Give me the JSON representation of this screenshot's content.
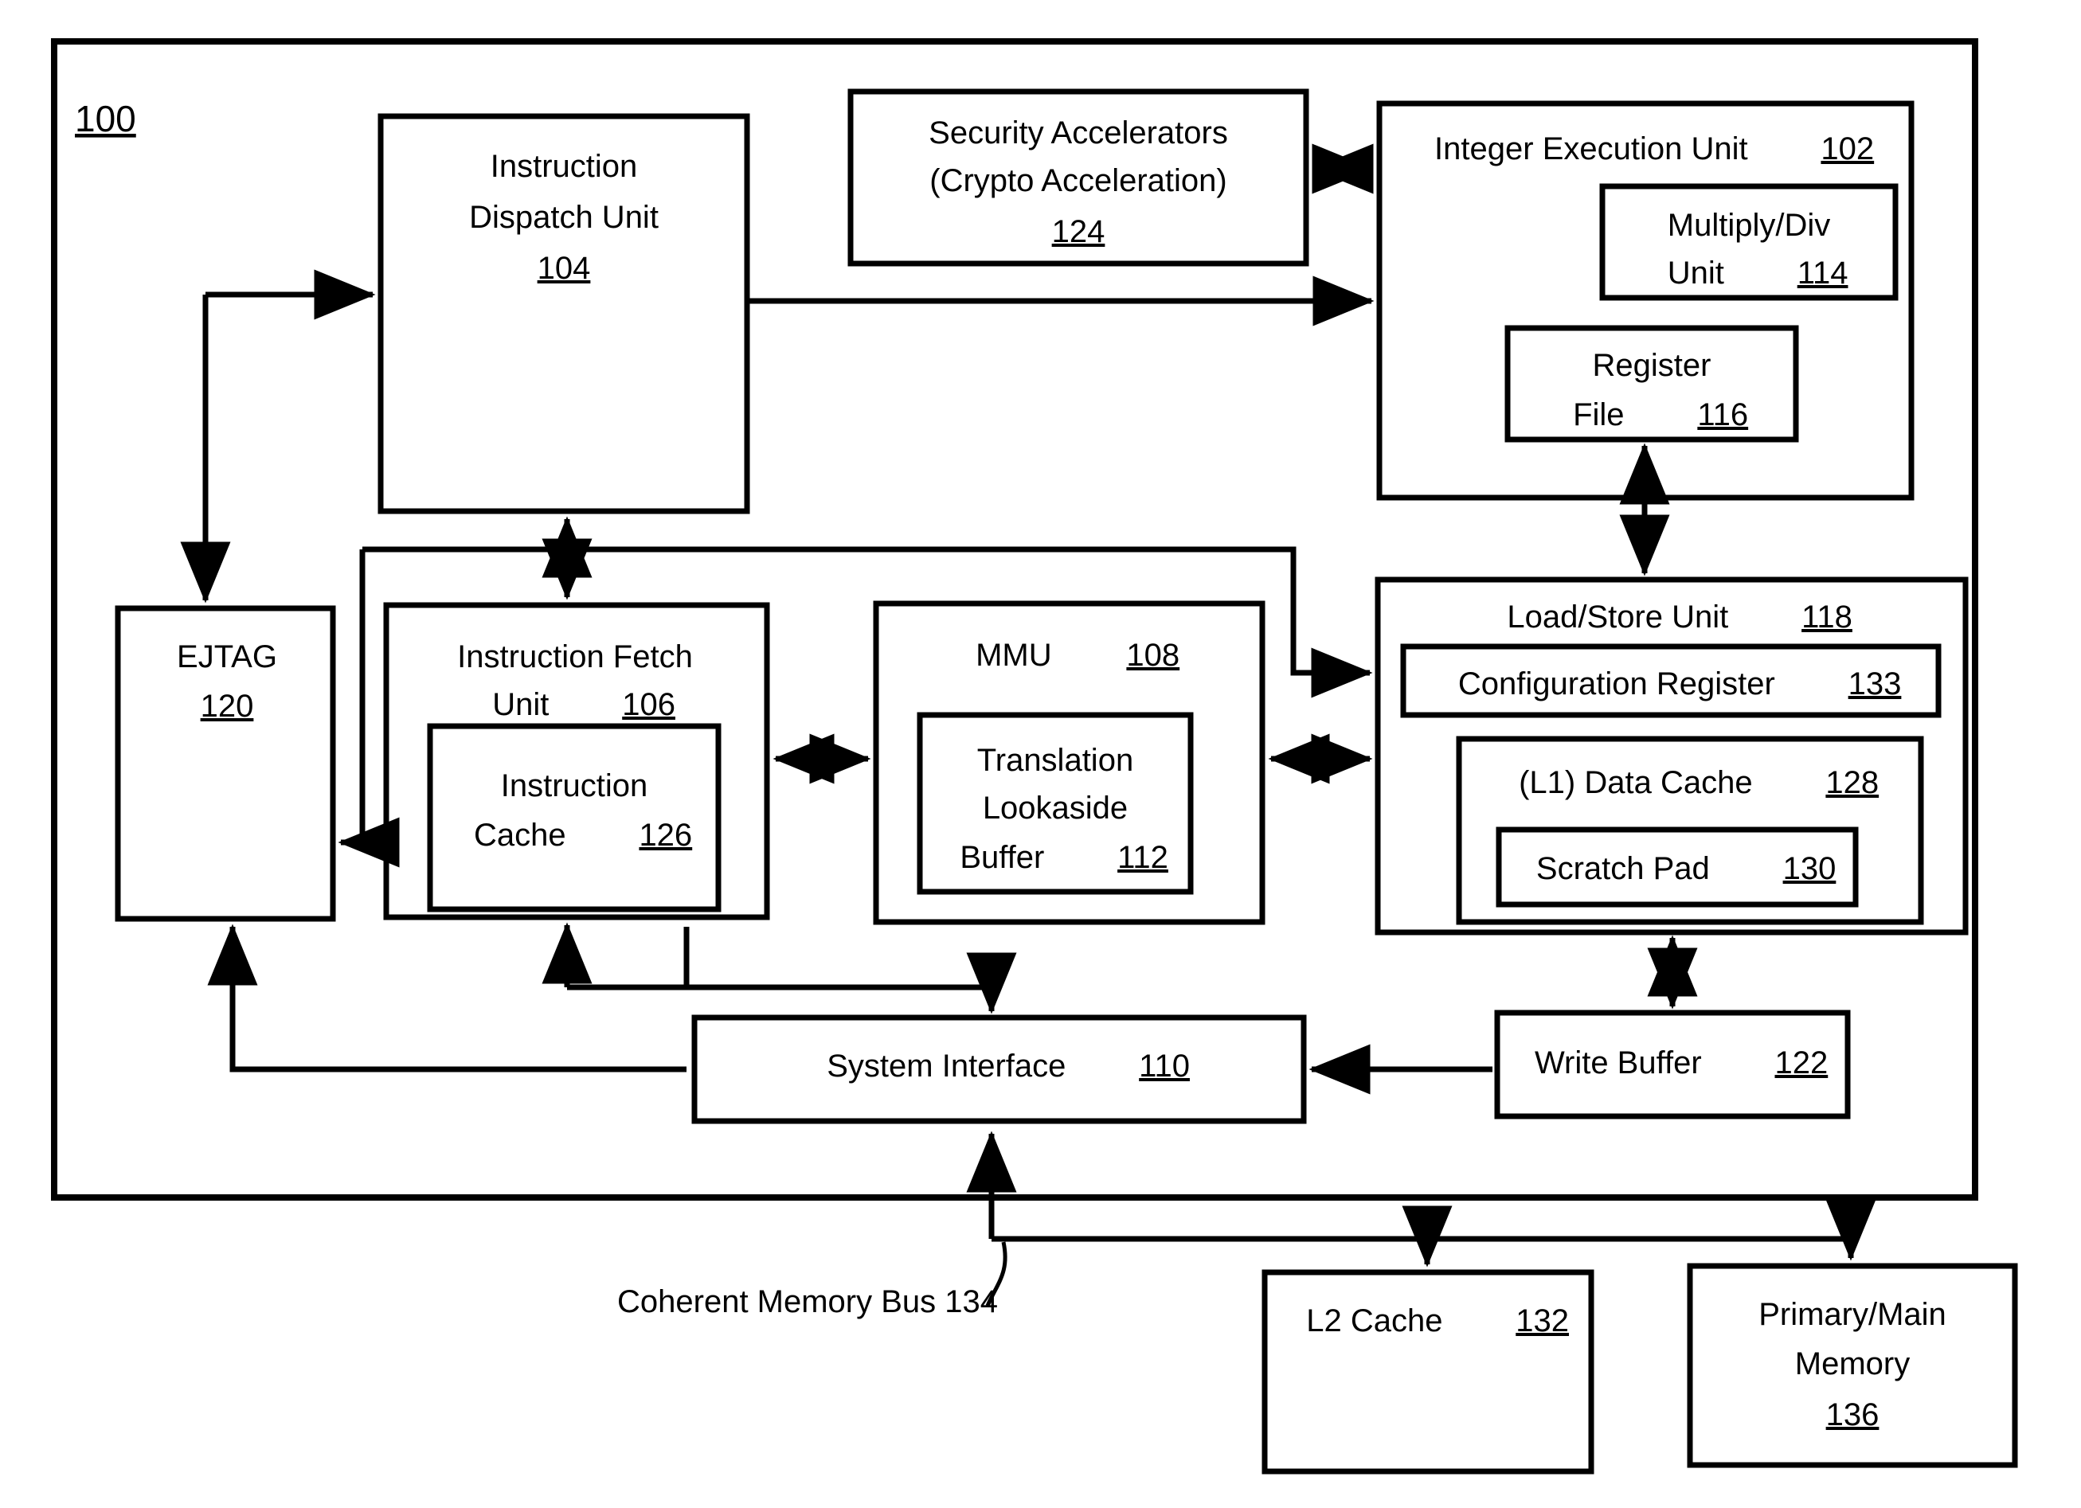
{
  "figure": {
    "reference_numeral": "100",
    "type": "processor-block-diagram"
  },
  "blocks": {
    "instruction_dispatch_unit": {
      "line1": "Instruction",
      "line2": "Dispatch Unit",
      "ref": "104"
    },
    "security_accelerators": {
      "line1": "Security Accelerators",
      "line2": "(Crypto Acceleration)",
      "ref": "124"
    },
    "integer_execution_unit": {
      "label": "Integer Execution Unit",
      "ref": "102"
    },
    "multiply_div_unit": {
      "line1": "Multiply/Div",
      "line2": "Unit",
      "ref": "114"
    },
    "register_file": {
      "line1": "Register",
      "line2": "File",
      "ref": "116"
    },
    "ejtag": {
      "label": "EJTAG",
      "ref": "120"
    },
    "instruction_fetch_unit": {
      "line1": "Instruction Fetch",
      "line2": "Unit",
      "ref": "106"
    },
    "instruction_cache": {
      "line1": "Instruction",
      "line2": "Cache",
      "ref": "126"
    },
    "mmu": {
      "label": "MMU",
      "ref": "108"
    },
    "translation_lookaside_buffer": {
      "line1": "Translation",
      "line2": "Lookaside",
      "line3": "Buffer",
      "ref": "112"
    },
    "load_store_unit": {
      "label": "Load/Store Unit",
      "ref": "118"
    },
    "configuration_register": {
      "label": "Configuration Register",
      "ref": "133"
    },
    "l1_data_cache": {
      "label": "(L1) Data Cache",
      "ref": "128"
    },
    "scratch_pad": {
      "label": "Scratch Pad",
      "ref": "130"
    },
    "system_interface": {
      "label": "System Interface",
      "ref": "110"
    },
    "write_buffer": {
      "label": "Write Buffer",
      "ref": "122"
    },
    "l2_cache": {
      "label": "L2 Cache",
      "ref": "132"
    },
    "primary_main_memory": {
      "line1": "Primary/Main",
      "line2": "Memory",
      "ref": "136"
    }
  },
  "annotations": {
    "coherent_memory_bus": {
      "label": "Coherent Memory Bus 134"
    }
  },
  "colors": {
    "line": "#000000",
    "fill": "#ffffff"
  }
}
